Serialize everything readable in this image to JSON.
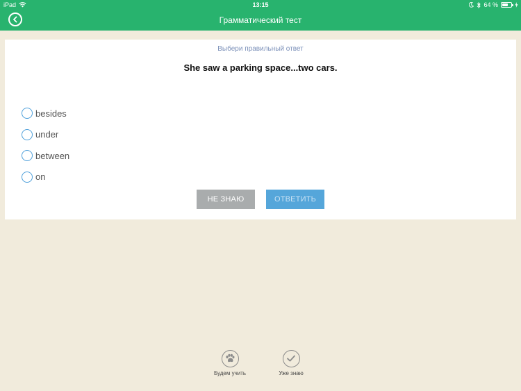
{
  "status_bar": {
    "device": "iPad",
    "time": "13:15",
    "battery": "64 %",
    "battery_level": 0.64
  },
  "nav": {
    "title": "Грамматический тест"
  },
  "quiz": {
    "instruction": "Выбери правильный ответ",
    "question": "She saw a parking space...two cars.",
    "options": [
      "besides",
      "under",
      "between",
      "on"
    ],
    "dont_know_label": "НЕ ЗНАЮ",
    "answer_label": "ОТВЕТИТЬ"
  },
  "bottom": {
    "learn_label": "Будем учить",
    "known_label": "Уже знаю"
  },
  "colors": {
    "header": "#28b36e",
    "background": "#f1ebdc",
    "radio": "#4d9fda",
    "answer_button": "#55a6da",
    "dont_know_button": "#a9acad"
  }
}
